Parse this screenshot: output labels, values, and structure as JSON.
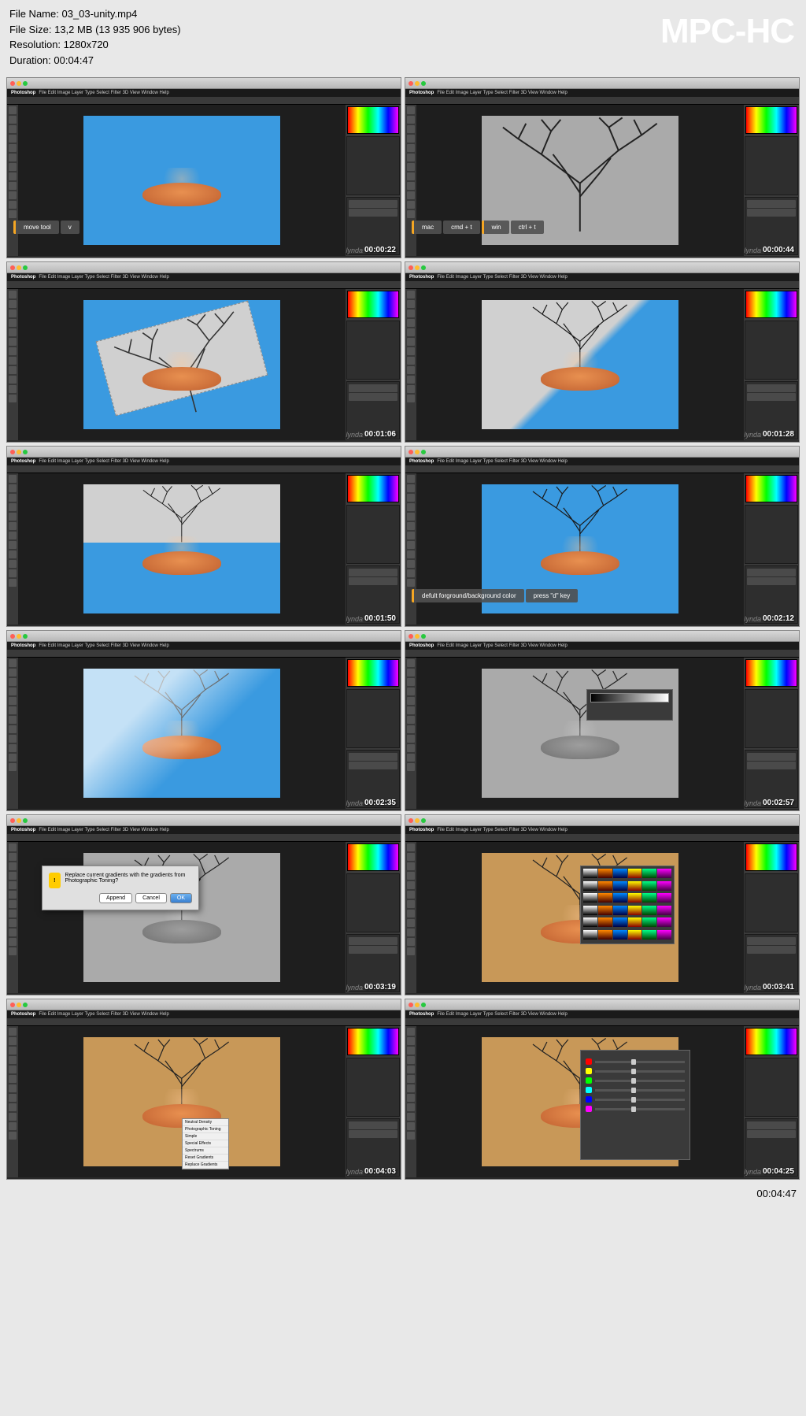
{
  "header": {
    "file_name_label": "File Name:",
    "file_name": "03_03-unity.mp4",
    "file_size_label": "File Size:",
    "file_size": "13,2 MB (13 935 906 bytes)",
    "resolution_label": "Resolution:",
    "resolution": "1280x720",
    "duration_label": "Duration:",
    "duration": "00:04:47",
    "watermark": "MPC-HC"
  },
  "app_name": "Photoshop",
  "menu_items": "File  Edit  Image  Layer  Type  Select  Filter  3D  View  Window  Help",
  "thumbs": [
    {
      "ts": "00:00:22",
      "captions": [
        {
          "text": "move tool",
          "accent": true
        },
        {
          "text": "v"
        }
      ],
      "canvas": "blue",
      "content": "jelly"
    },
    {
      "ts": "00:00:44",
      "captions": [
        {
          "text": "mac",
          "accent": true
        },
        {
          "text": "cmd + t"
        },
        {
          "text": "win",
          "accent": true
        },
        {
          "text": "ctrl + t"
        }
      ],
      "canvas": "gray",
      "content": "tree"
    },
    {
      "ts": "00:01:06",
      "canvas": "blue",
      "content": "rotated"
    },
    {
      "ts": "00:01:28",
      "canvas": "diagonal",
      "content": "treejelly"
    },
    {
      "ts": "00:01:50",
      "canvas": "blue",
      "content": "treejelly-half"
    },
    {
      "ts": "00:02:12",
      "captions": [
        {
          "text": "defult forground/background color",
          "accent": true
        },
        {
          "text": "press \"d\" key"
        }
      ],
      "canvas": "blue",
      "content": "treejelly"
    },
    {
      "ts": "00:02:35",
      "canvas": "blue",
      "content": "treejelly-grad"
    },
    {
      "ts": "00:02:57",
      "canvas": "gray",
      "content": "treejelly-bw",
      "overlay": "gradient-strip"
    },
    {
      "ts": "00:03:19",
      "canvas": "gray",
      "content": "treejelly-bw",
      "overlay": "dialog"
    },
    {
      "ts": "00:03:41",
      "canvas": "sepia",
      "content": "treejelly",
      "overlay": "gradient-grid"
    },
    {
      "ts": "00:04:03",
      "canvas": "sepia",
      "content": "treejelly",
      "overlay": "context-menu"
    },
    {
      "ts": "00:04:25",
      "canvas": "sepia",
      "content": "treejelly",
      "overlay": "bw-adjust"
    }
  ],
  "dialog": {
    "text": "Replace current gradients with the gradients from Photographic Toning?",
    "append": "Append",
    "cancel": "Cancel",
    "ok": "OK"
  },
  "bw_sliders": [
    "#ff0000",
    "#ffff00",
    "#00ff00",
    "#00ffff",
    "#0000ff",
    "#ff00ff"
  ],
  "context_items": [
    "Neutral Density",
    "Photographic Toning",
    "Simple",
    "Special Effects",
    "Spectrums",
    "Reset Gradients",
    "Replace Gradients"
  ],
  "footer_time": "00:04:47",
  "lynda": "lynda"
}
